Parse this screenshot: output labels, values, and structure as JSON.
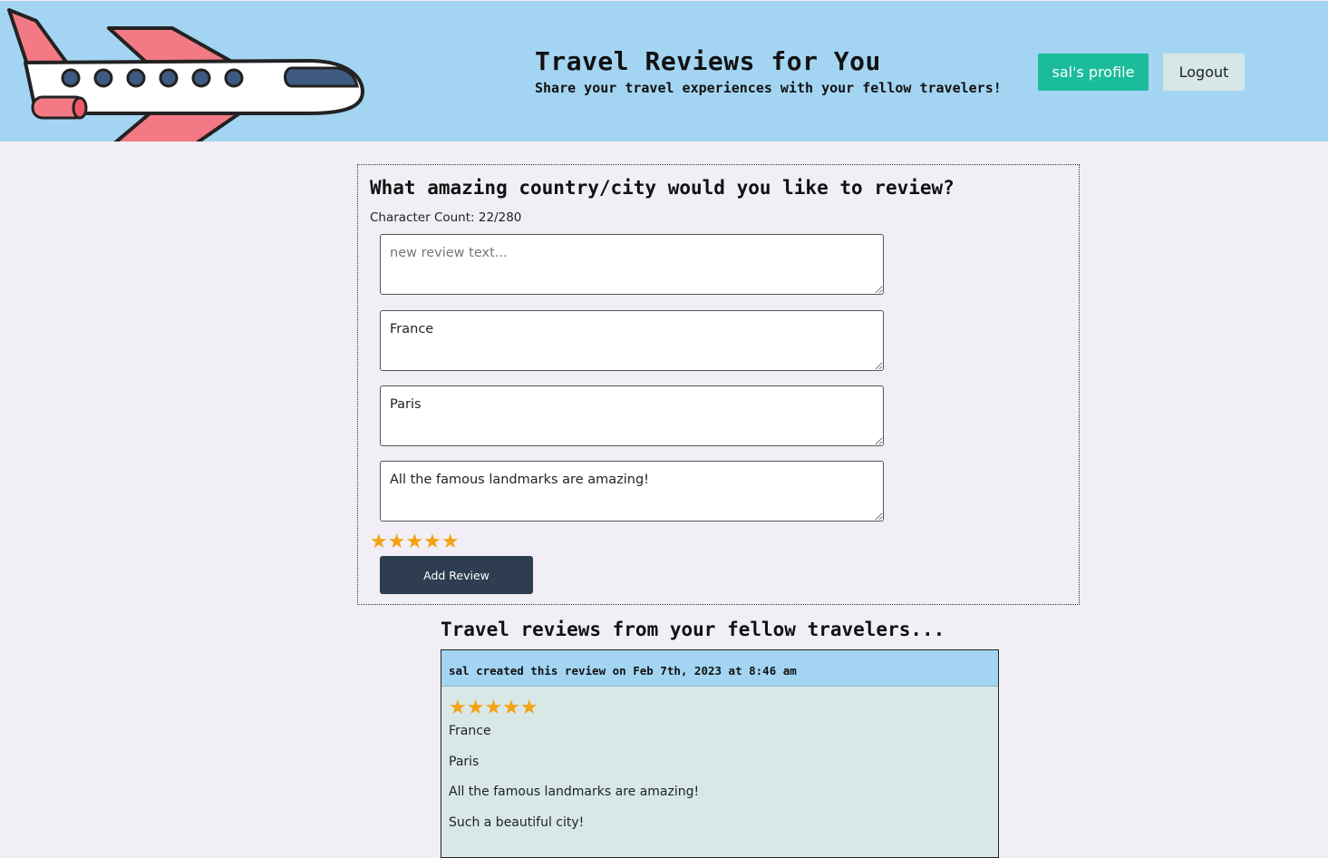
{
  "header": {
    "title": "Travel Reviews for You",
    "subtitle": "Share your travel experiences with your fellow travelers!",
    "profile_button": "sal's profile",
    "logout_button": "Logout",
    "logo_icon": "airplane-icon"
  },
  "form": {
    "heading": "What amazing country/city would you like to review?",
    "char_count": "Character Count: 22/280",
    "review_text_placeholder": "new review text...",
    "country_value": "France",
    "city_value": "Paris",
    "comment_value": "All the famous landmarks are amazing!",
    "rating": 5,
    "stars_display": "★★★★★",
    "add_button": "Add Review"
  },
  "reviews": {
    "heading": "Travel reviews from your fellow travelers...",
    "items": [
      {
        "meta": "sal created this review on Feb 7th, 2023 at 8:46 am",
        "stars_display": "★★★★★",
        "rating": 5,
        "country": "France",
        "city": "Paris",
        "comment": "All the famous landmarks are amazing!",
        "extra": "Such a beautiful city!"
      }
    ]
  },
  "colors": {
    "header_bg": "#a3d5f3",
    "page_bg": "#f1eef6",
    "profile_button": "#1bbc9b",
    "logout_button": "#d7e6e7",
    "add_button": "#2e3d50",
    "star": "#f4a211",
    "card_bg": "#d8e8e7"
  }
}
